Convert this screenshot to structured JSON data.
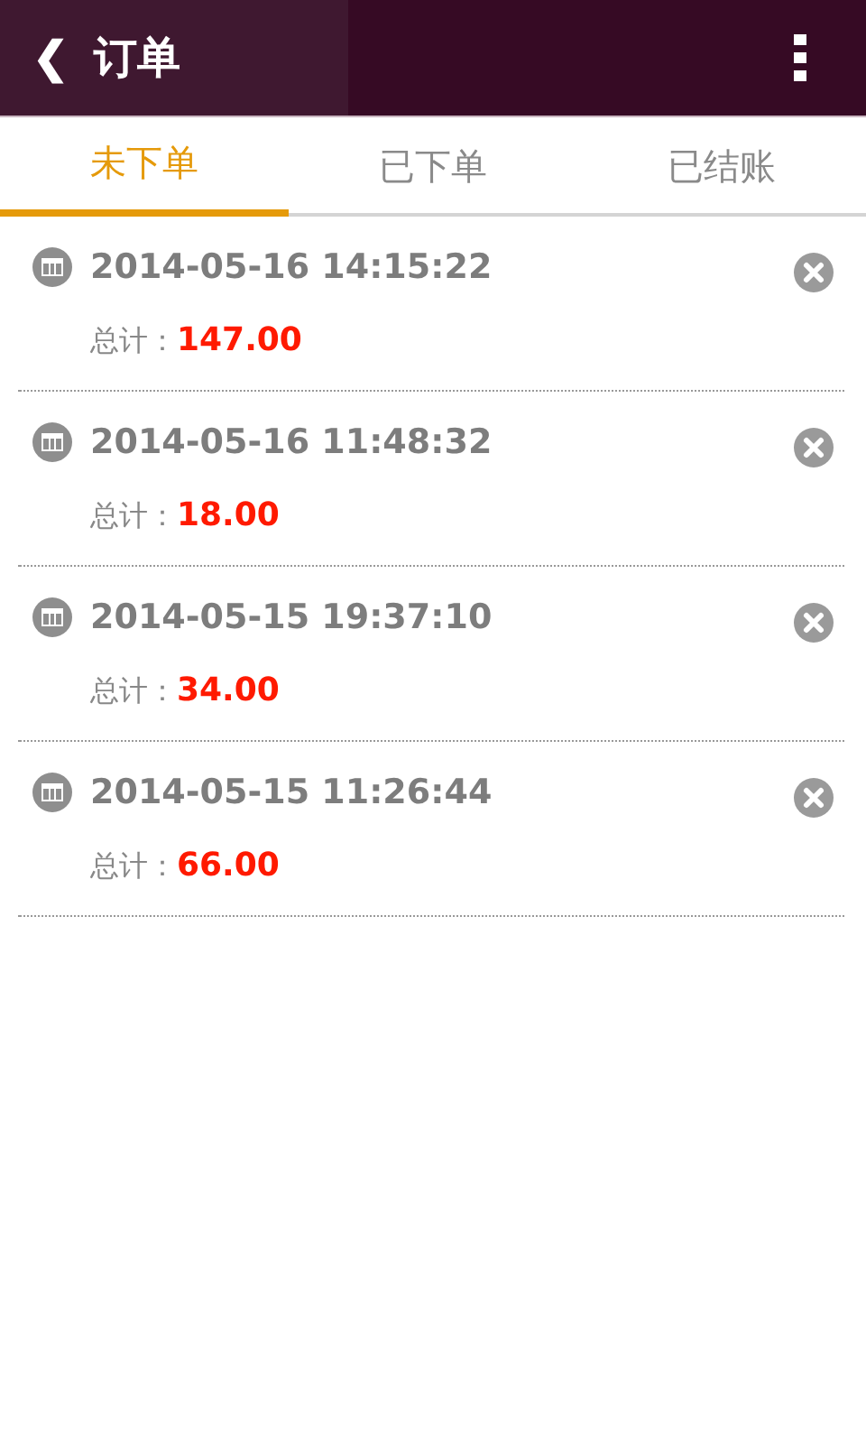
{
  "header": {
    "back": "❮",
    "title": "订单"
  },
  "tabs": [
    {
      "label": "未下单",
      "selected": true
    },
    {
      "label": "已下单",
      "selected": false
    },
    {
      "label": "已结账",
      "selected": false
    }
  ],
  "orders": [
    {
      "time": "2014-05-16 14:15:22",
      "total_label": "总计：",
      "total": "147.00"
    },
    {
      "time": "2014-05-16 11:48:32",
      "total_label": "总计：",
      "total": "18.00"
    },
    {
      "time": "2014-05-15 19:37:10",
      "total_label": "总计：",
      "total": "34.00"
    },
    {
      "time": "2014-05-15 11:26:44",
      "total_label": "总计：",
      "total": "66.00"
    }
  ]
}
